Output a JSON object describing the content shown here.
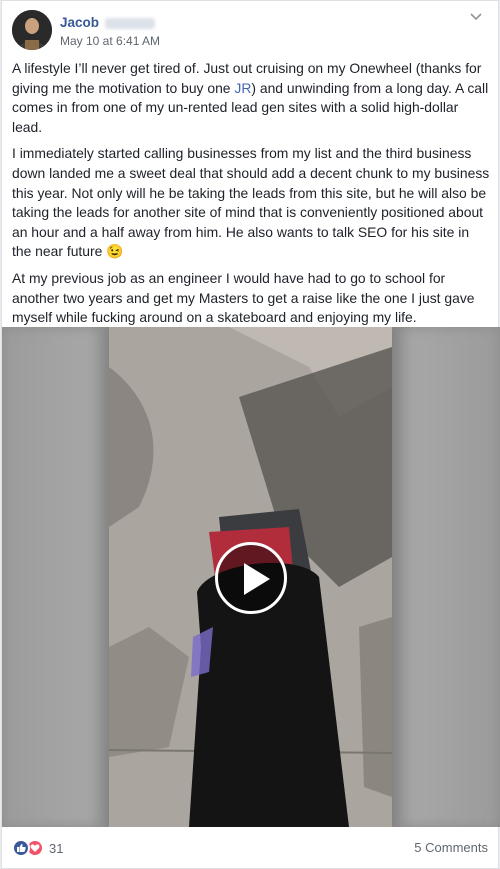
{
  "post": {
    "author": "Jacob",
    "timestamp": "May 10 at 6:41 AM",
    "paragraph1_a": "A lifestyle I’ll never get tired of. Just out cruising on my Onewheel (thanks for giving me the motivation to buy one ",
    "paragraph1_link": "JR",
    "paragraph1_b": ") and unwinding from a long day. A call comes in from one of my un-rented lead gen sites with a solid high-dollar lead.",
    "paragraph2": "I immediately started calling businesses from my list and the third business down landed me a sweet deal that should add a decent chunk to my business this year. Not only will he be taking the leads from this site, but he will also be taking the leads for another site of mind that is conveniently positioned about an hour and a half away from him. He also wants to talk SEO for his site in the near future",
    "emoji": "😉",
    "paragraph3": "At my previous job as an engineer I would have had to go to school for another two years and get my Masters to get a raise like the one I just gave myself while fucking around on a skateboard and enjoying my life."
  },
  "footer": {
    "reaction_count": "31",
    "comments_label": "5 Comments"
  },
  "icons": [
    "chevron-down-icon",
    "play-icon",
    "like-icon",
    "love-icon"
  ],
  "colors": {
    "link": "#4267b2",
    "author": "#385898",
    "like": "#3b5998",
    "love": "#f25268"
  }
}
